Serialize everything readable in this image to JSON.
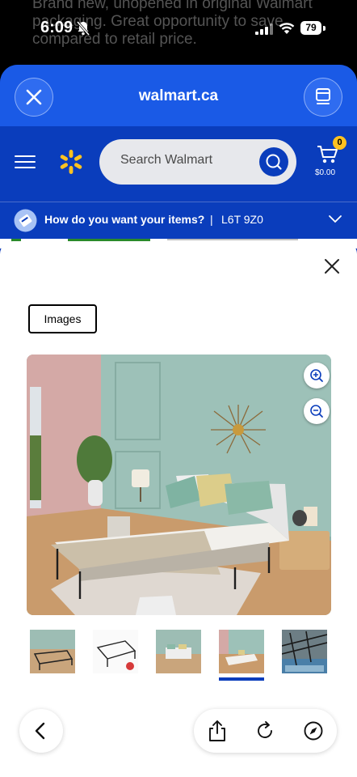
{
  "background": {
    "text": "Brand new, unopened in original Walmart packaging. Great opportunity to save compared to retail price."
  },
  "status_bar": {
    "time": "6:09",
    "battery": "79"
  },
  "browser": {
    "domain": "walmart.ca"
  },
  "header": {
    "search_placeholder": "Search Walmart",
    "cart_count": "0",
    "cart_total": "$0.00"
  },
  "delivery": {
    "question": "How do you want your items?",
    "separator": "|",
    "postal_code": "L6T 9Z0"
  },
  "modal": {
    "tab_label": "Images",
    "thumbnail_count": 5,
    "selected_thumbnail": 4
  },
  "icons": [
    "close-icon",
    "menu-icon",
    "walmart-spark-icon",
    "search-icon",
    "cart-icon",
    "chevron-down-icon",
    "zoom-in-icon",
    "zoom-out-icon",
    "back-icon",
    "share-icon",
    "reload-icon",
    "compass-icon"
  ],
  "colors": {
    "walmart_blue": "#0a3dbc",
    "browser_blue": "#1a5ae6",
    "spark_yellow": "#ffc220"
  }
}
